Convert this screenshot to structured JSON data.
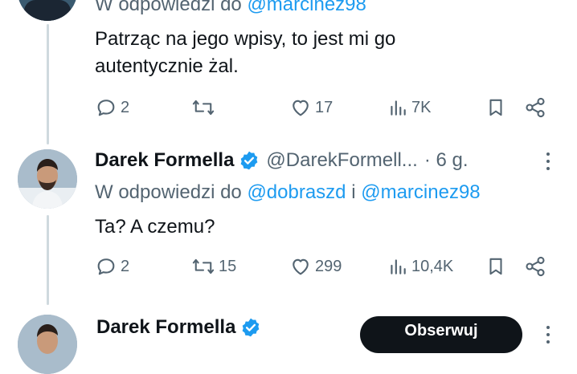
{
  "tweet1": {
    "reply_label": "W odpowiedzi do",
    "reply_mention": "@marcinez98",
    "text_line1": "Patrząc na jego wpisy, to jest mi go",
    "text_line2": "autentycznie żal.",
    "stats": {
      "replies": "2",
      "retweets": "",
      "likes": "17",
      "views": "7K"
    }
  },
  "tweet2": {
    "author_name": "Darek Formella",
    "handle": "@DarekFormell...",
    "time": "· 6 g.",
    "reply_label": "W odpowiedzi do",
    "reply_mention1": "@dobraszd",
    "reply_and": "i",
    "reply_mention2": "@marcinez98",
    "text": "Ta? A czemu?",
    "stats": {
      "replies": "2",
      "retweets": "15",
      "likes": "299",
      "views": "10,4K"
    }
  },
  "tweet3": {
    "author_name": "Darek Formella",
    "follow_label": "Obserwuj"
  },
  "colors": {
    "accent": "#1d9bf0",
    "text": "#0f1419",
    "secondary": "#536471",
    "follow_bg": "#0f1419"
  }
}
